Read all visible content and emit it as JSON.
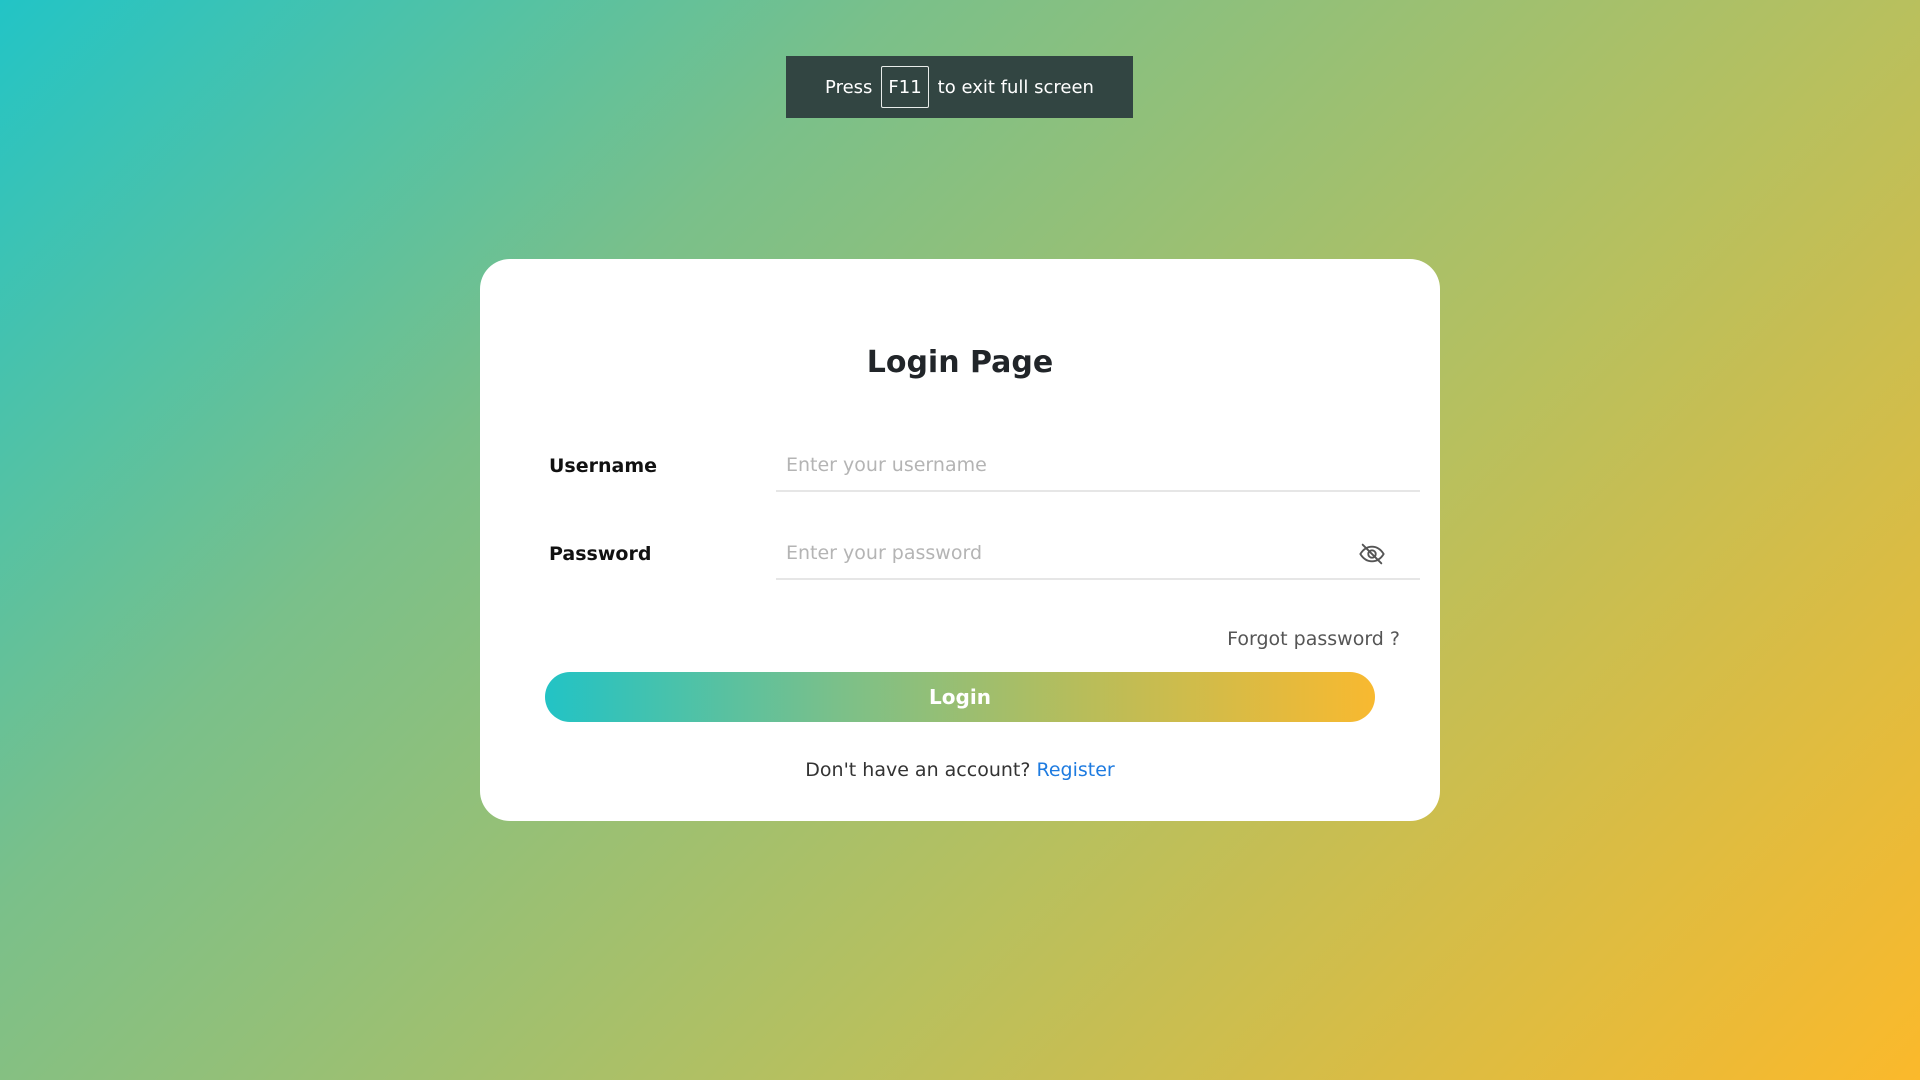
{
  "fullscreen_banner": {
    "press": "Press",
    "key": "F11",
    "message": "to exit full screen"
  },
  "login_card": {
    "title": "Login Page",
    "username_label": "Username",
    "username_placeholder": "Enter your username",
    "username_value": "",
    "password_label": "Password",
    "password_placeholder": "Enter your password",
    "password_value": "",
    "password_toggle_icon": "eye-slash-icon",
    "forgot_password": "Forgot password ?",
    "login_button": "Login",
    "register_prompt": "Don't have an account?",
    "register_link": "Register"
  },
  "colors": {
    "gradient_start": "#22c4c6",
    "gradient_end": "#fbb92b",
    "banner_bg": "#324542",
    "link": "#1e7be0"
  }
}
